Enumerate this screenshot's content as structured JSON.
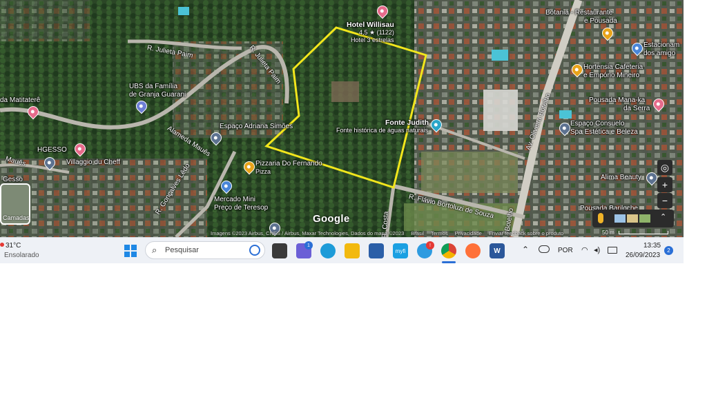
{
  "map": {
    "google_logo": "Google",
    "layers_label": "Camadas",
    "attribution": [
      "Imagens ©2023 Airbus, CNES / Airbus, Maxar Technologies, Dados do mapa ©2023",
      "Brasil",
      "Termos",
      "Privacidade",
      "Enviar feedback sobre o produto"
    ],
    "scale": "50 m",
    "places": [
      {
        "name": "Hotel Willisau",
        "sub": "4,5 ★ (1122)",
        "sub2": "Hotel 3 estrelas"
      },
      {
        "name": "Botania - Restaurante",
        "sub": "e Pousada"
      },
      {
        "name": "Estacionam",
        "sub": "dos amigo"
      },
      {
        "name": "Hortensia Cafeteria",
        "sub": "e Empório Mineiro"
      },
      {
        "name": "Pousada Mana-ka",
        "sub": "da Serra"
      },
      {
        "name": "Fonte Judith",
        "sub": "Fonte histórica de águas naturais"
      },
      {
        "name": "Espaço Consuelo",
        "sub": "Spa Estética e Beleza"
      },
      {
        "name": "Alima Beauty"
      },
      {
        "name": "Pousada Bariloche"
      },
      {
        "name": "UBS da Família",
        "sub": "de Granja Guarani"
      },
      {
        "name": "Espaço Adriana Simões"
      },
      {
        "name": "da Matitaterê"
      },
      {
        "name": "HGESSO"
      },
      {
        "name": "Villaggio du Cheff"
      },
      {
        "name": "Pizzaria Do Fernando",
        "sub": "Pizza"
      },
      {
        "name": "Mercado Mini",
        "sub": "Preço de Teresop"
      },
      {
        "name": "Gesso"
      }
    ],
    "roads": [
      "R. Julieta Paim",
      "R. Julieta Paim",
      "Alameda Mauês",
      "R. Gonçalves Lêdo",
      "Av. Oliveira Botelho",
      "R. Flávio Bortoluzi de Souza",
      "Botelho",
      "R. Costa",
      "Mauês"
    ]
  },
  "taskbar": {
    "weather_temp": "31°C",
    "weather_text": "Ensolarado",
    "search_placeholder": "Pesquisar",
    "lang": "POR",
    "time": "13:35",
    "date": "26/09/2023",
    "notif_count": "2",
    "chat_badge": "1",
    "help_badge": "!",
    "word_letter": "W",
    "store_label": "myfi"
  },
  "colors": {
    "boundary": "#f2e61c",
    "canopy": "#243d22",
    "taskbar_bg": "#eef1f6",
    "pin_pink": "#e76b8b",
    "pin_orange": "#e8a31a"
  }
}
